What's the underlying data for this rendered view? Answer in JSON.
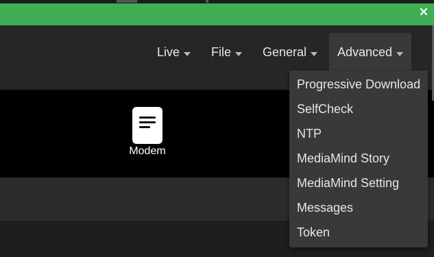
{
  "nav": {
    "items": [
      {
        "label": "Live"
      },
      {
        "label": "File"
      },
      {
        "label": "General"
      },
      {
        "label": "Advanced"
      }
    ]
  },
  "tile": {
    "label": "Modem",
    "icon": "document-icon"
  },
  "dropdown": {
    "items": [
      "Progressive Download",
      "SelfCheck",
      "NTP",
      "MediaMind Story",
      "MediaMind Setting",
      "Messages",
      "Token"
    ]
  },
  "colors": {
    "accent": "#3fae55",
    "background": "#262626",
    "menu": "#393939"
  }
}
